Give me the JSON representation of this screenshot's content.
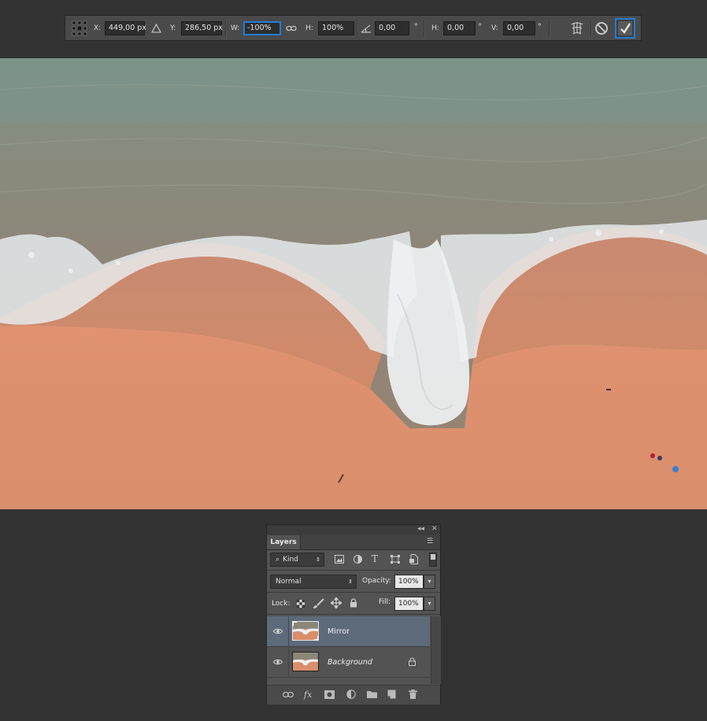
{
  "options_bar": {
    "x_label": "X:",
    "x_value": "449,00 px",
    "y_label": "Y:",
    "y_value": "286,50 px",
    "w_label": "W:",
    "w_value": "-100%",
    "h_label": "H:",
    "h_value": "100%",
    "rotate_value": "0,00",
    "skew_h_label": "H:",
    "skew_h_value": "0,00",
    "skew_v_label": "V:",
    "skew_v_value": "0,00",
    "degree_symbol": "°",
    "icons": [
      "reference-point-grid-icon",
      "relative-position-triangle-icon",
      "link-constrain-icon",
      "rotate-angle-icon",
      "warp-mode-icon",
      "cancel-transform-icon",
      "commit-transform-icon"
    ]
  },
  "layers_panel": {
    "tab_label": "Layers",
    "filter_kind": "Kind",
    "blend_mode": "Normal",
    "opacity_label": "Opacity:",
    "opacity_value": "100%",
    "lock_label": "Lock:",
    "fill_label": "Fill:",
    "fill_value": "100%",
    "layers": [
      {
        "name": "Mirror",
        "selected": true,
        "visible": true,
        "locked": false
      },
      {
        "name": "Background",
        "selected": false,
        "visible": true,
        "locked": true
      }
    ]
  },
  "colors": {
    "accent": "#1f7fd6",
    "selected_layer": "#5c6a7a",
    "workspace": "#333333"
  }
}
